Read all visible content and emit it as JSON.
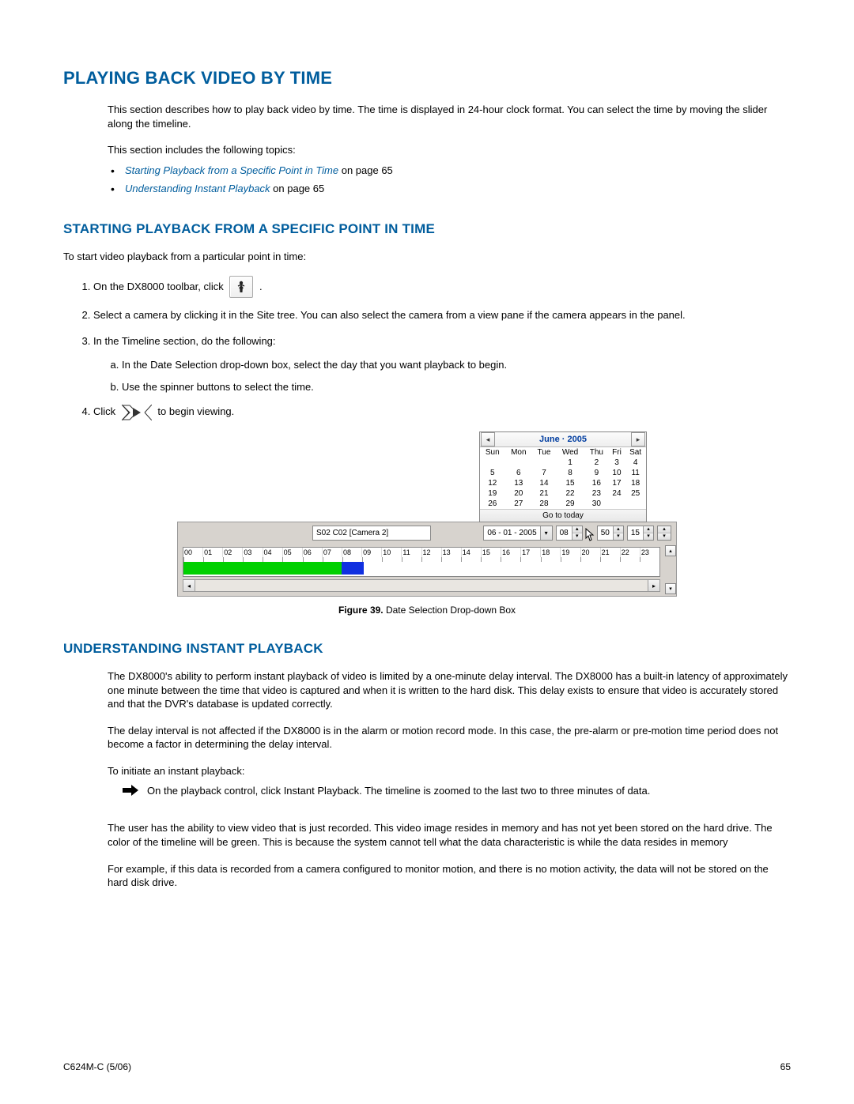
{
  "headings": {
    "h1": "Playing Back Video by Time",
    "h2a": "Starting Playback from a Specific Point in Time",
    "h2b": "Understanding Instant Playback"
  },
  "intro": {
    "p1": "This section describes how to play back video by time. The time is displayed in 24-hour clock format. You can select the time by moving the slider along the timeline.",
    "p2": "This section includes the following topics:"
  },
  "toc": {
    "item1_link": "Starting Playback from a Specific Point in Time",
    "item1_rest": " on page 65",
    "item2_link": "Understanding Instant Playback",
    "item2_rest": " on page 65"
  },
  "start": {
    "intro": "To start video playback from a particular point in time:",
    "step1_a": "On the DX8000 toolbar, click ",
    "step1_b": " .",
    "step2": "Select a camera by clicking it in the Site tree. You can also select the camera from a view pane if the camera appears in the panel.",
    "step3": "In the Timeline section, do the following:",
    "step3a": "In the Date Selection drop-down box, select the day that you want playback to begin.",
    "step3b": "Use the spinner buttons to select the time.",
    "step4_a": "Click ",
    "step4_b": " to begin viewing."
  },
  "figure": {
    "cal_title": "June · 2005",
    "dow": [
      "Sun",
      "Mon",
      "Tue",
      "Wed",
      "Thu",
      "Fri",
      "Sat"
    ],
    "weeks": [
      [
        "",
        "",
        "",
        "1",
        "2",
        "3",
        "4"
      ],
      [
        "5",
        "6",
        "7",
        "8",
        "9",
        "10",
        "11"
      ],
      [
        "12",
        "13",
        "14",
        "15",
        "16",
        "17",
        "18"
      ],
      [
        "19",
        "20",
        "21",
        "22",
        "23",
        "24",
        "25"
      ],
      [
        "26",
        "27",
        "28",
        "29",
        "30",
        "",
        ""
      ]
    ],
    "go_today": "Go to today",
    "camera_label": "S02 C02 [Camera 2]",
    "date_value": "06 - 01 - 2005",
    "time_h": "08",
    "time_m": "50",
    "time_s": "15",
    "hours": [
      "00",
      "01",
      "02",
      "03",
      "04",
      "05",
      "06",
      "07",
      "08",
      "09",
      "10",
      "11",
      "12",
      "13",
      "14",
      "15",
      "16",
      "17",
      "18",
      "19",
      "20",
      "21",
      "22",
      "23"
    ],
    "caption_label": "Figure 39.",
    "caption_text": "  Date Selection Drop-down Box"
  },
  "understand": {
    "p1": "The DX8000's ability to perform instant playback of video is limited by a one-minute delay interval. The DX8000 has a built-in latency of approximately one minute between the time that video is captured and when it is written to the hard disk. This delay exists to ensure that video is accurately stored and that the DVR's database is updated correctly.",
    "p2": "The delay interval is not affected if the DX8000 is in the alarm or motion record mode. In this case, the pre-alarm or pre-motion time period does not become a factor in determining the delay interval.",
    "p3": "To initiate an instant playback:",
    "p4": "On the playback control, click Instant Playback. The timeline is zoomed to the last two to three minutes of data.",
    "p5": "The user has the ability to view video that is just recorded. This video image resides in memory and has not yet been stored on the hard drive. The color of the timeline will be green. This is because the system cannot tell what the data characteristic is while the data resides in memory",
    "p6": "For example, if this data is recorded from a camera configured to monitor motion, and there is no motion activity, the data will not be stored on the hard disk drive."
  },
  "footer": {
    "left": "C624M-C (5/06)",
    "right": "65"
  }
}
